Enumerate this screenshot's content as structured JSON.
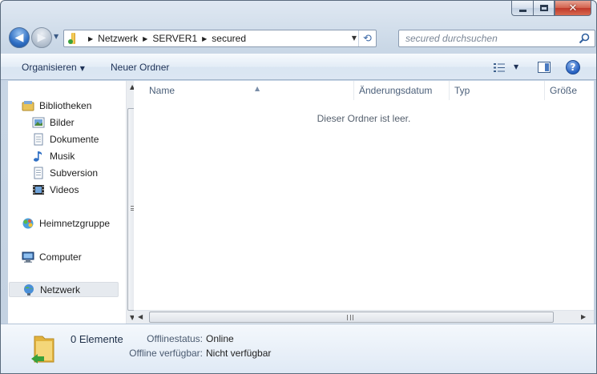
{
  "window": {
    "caption_buttons": {
      "minimize_icon": "minimize-icon",
      "maximize_icon": "maximize-icon",
      "close_glyph": "✕"
    }
  },
  "navigation": {
    "back_glyph": "◀",
    "forward_glyph": "▶",
    "breadcrumbs": [
      "Netzwerk",
      "SERVER1",
      "secured"
    ],
    "search_placeholder": "secured durchsuchen"
  },
  "commandbar": {
    "organize_label": "Organisieren",
    "new_folder_label": "Neuer Ordner"
  },
  "sidebar": {
    "items": [
      {
        "label": "Bibliotheken",
        "icon": "libraries-icon"
      },
      {
        "label": "Bilder",
        "icon": "pictures-icon"
      },
      {
        "label": "Dokumente",
        "icon": "documents-icon"
      },
      {
        "label": "Musik",
        "icon": "music-icon"
      },
      {
        "label": "Subversion",
        "icon": "subversion-icon"
      },
      {
        "label": "Videos",
        "icon": "videos-icon"
      },
      {
        "label": "Heimnetzgruppe",
        "icon": "homegroup-icon"
      },
      {
        "label": "Computer",
        "icon": "computer-icon"
      },
      {
        "label": "Netzwerk",
        "icon": "network-icon",
        "selected": true
      }
    ]
  },
  "content": {
    "columns": [
      "Name",
      "Änderungsdatum",
      "Typ",
      "Größe"
    ],
    "sorted_column": "Name",
    "empty_message": "Dieser Ordner ist leer."
  },
  "details": {
    "item_count": "0 Elemente",
    "offline_status_label": "Offlinestatus:",
    "offline_status_value": "Online",
    "offline_available_label": "Offline verfügbar:",
    "offline_available_value": "Nicht verfügbar"
  },
  "colors": {
    "accent": "#245fc0",
    "command_text": "#1e3257",
    "selection": "#e6eaef"
  }
}
